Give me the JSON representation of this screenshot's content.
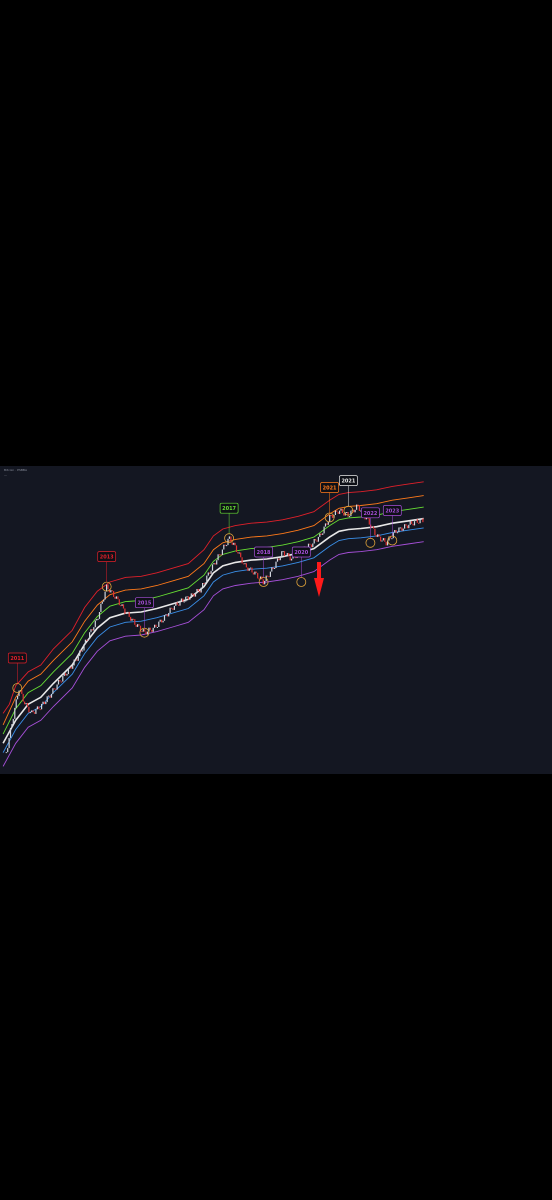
{
  "header": {
    "title": "Bitcoin · PSBBA",
    "subtitle": "—"
  },
  "colors": {
    "background": "#000000",
    "panel": "#141722",
    "bands": [
      "#e0202a",
      "#ff7a1a",
      "#66dd33",
      "#e8e8e8",
      "#3a8fe8",
      "#a64fd8"
    ],
    "candle_up": "#cfd4dc",
    "candle_down": "#e03333",
    "arrow": "#ff1a1a",
    "circle": "#e0a33a"
  },
  "chart_data": {
    "type": "line",
    "title": "",
    "xlabel": "",
    "ylabel": "",
    "x_range": [
      2010.5,
      2024.2
    ],
    "y_scale": "log",
    "grid": false,
    "legend": "none",
    "series": [
      {
        "role": "band-1",
        "color": "#e0202a",
        "x": [
          2010.6,
          2010.8,
          2011.0,
          2011.4,
          2011.8,
          2012.2,
          2012.8,
          2013.2,
          2013.6,
          2014.0,
          2014.5,
          2015.0,
          2015.5,
          2016.0,
          2016.5,
          2017.0,
          2017.3,
          2017.6,
          2018.0,
          2018.5,
          2019.0,
          2019.5,
          2020.0,
          2020.5,
          2021.0,
          2021.3,
          2021.6,
          2022.0,
          2022.5,
          2023.0,
          2023.5,
          2024.0
        ],
        "y": [
          1.2,
          1.6,
          2.4,
          3.0,
          3.3,
          4.0,
          4.8,
          5.8,
          6.5,
          6.9,
          7.1,
          7.15,
          7.3,
          7.5,
          7.7,
          8.3,
          8.9,
          9.2,
          9.35,
          9.45,
          9.5,
          9.6,
          9.75,
          9.95,
          10.45,
          10.7,
          10.78,
          10.82,
          10.9,
          11.05,
          11.15,
          11.25
        ]
      },
      {
        "role": "band-2",
        "color": "#ff7a1a",
        "x": [
          2010.6,
          2011.0,
          2011.4,
          2011.8,
          2012.2,
          2012.8,
          2013.2,
          2013.6,
          2014.0,
          2014.5,
          2015.0,
          2015.5,
          2016.0,
          2016.5,
          2017.0,
          2017.3,
          2017.6,
          2018.0,
          2018.5,
          2019.0,
          2019.5,
          2020.0,
          2020.5,
          2021.0,
          2021.3,
          2021.6,
          2022.0,
          2022.5,
          2023.0,
          2023.5,
          2024.0
        ],
        "y": [
          0.7,
          1.9,
          2.6,
          2.9,
          3.5,
          4.3,
          5.2,
          5.9,
          6.35,
          6.55,
          6.6,
          6.75,
          6.95,
          7.15,
          7.7,
          8.3,
          8.6,
          8.75,
          8.85,
          8.9,
          9.0,
          9.15,
          9.35,
          9.85,
          10.1,
          10.18,
          10.22,
          10.3,
          10.45,
          10.55,
          10.65
        ]
      },
      {
        "role": "band-3",
        "color": "#66dd33",
        "x": [
          2010.6,
          2011.0,
          2011.4,
          2011.8,
          2012.2,
          2012.8,
          2013.2,
          2013.6,
          2014.0,
          2014.5,
          2015.0,
          2015.5,
          2016.0,
          2016.5,
          2017.0,
          2017.3,
          2017.6,
          2018.0,
          2018.5,
          2019.0,
          2019.5,
          2020.0,
          2020.5,
          2021.0,
          2021.3,
          2021.6,
          2022.0,
          2022.5,
          2023.0,
          2023.5,
          2024.0
        ],
        "y": [
          0.3,
          1.4,
          2.1,
          2.4,
          3.0,
          3.8,
          4.7,
          5.4,
          5.85,
          6.05,
          6.1,
          6.25,
          6.45,
          6.65,
          7.2,
          7.8,
          8.1,
          8.25,
          8.35,
          8.4,
          8.5,
          8.65,
          8.85,
          9.35,
          9.6,
          9.68,
          9.72,
          9.8,
          9.95,
          10.05,
          10.15
        ]
      },
      {
        "role": "band-4",
        "color": "#e8e8e8",
        "x": [
          2010.6,
          2011.0,
          2011.4,
          2011.8,
          2012.2,
          2012.8,
          2013.2,
          2013.6,
          2014.0,
          2014.5,
          2015.0,
          2015.5,
          2016.0,
          2016.5,
          2017.0,
          2017.3,
          2017.6,
          2018.0,
          2018.5,
          2019.0,
          2019.5,
          2020.0,
          2020.5,
          2021.0,
          2021.3,
          2021.6,
          2022.0,
          2022.5,
          2023.0,
          2023.5,
          2024.0
        ],
        "y": [
          -0.1,
          0.9,
          1.6,
          1.9,
          2.5,
          3.3,
          4.2,
          4.9,
          5.35,
          5.55,
          5.6,
          5.75,
          5.95,
          6.15,
          6.7,
          7.3,
          7.6,
          7.75,
          7.85,
          7.9,
          8.0,
          8.15,
          8.35,
          8.85,
          9.1,
          9.18,
          9.22,
          9.3,
          9.45,
          9.55,
          9.65
        ]
      },
      {
        "role": "band-5",
        "color": "#3a8fe8",
        "x": [
          2010.6,
          2011.0,
          2011.4,
          2011.8,
          2012.2,
          2012.8,
          2013.2,
          2013.6,
          2014.0,
          2014.5,
          2015.0,
          2015.5,
          2016.0,
          2016.5,
          2017.0,
          2017.3,
          2017.6,
          2018.0,
          2018.5,
          2019.0,
          2019.5,
          2020.0,
          2020.5,
          2021.0,
          2021.3,
          2021.6,
          2022.0,
          2022.5,
          2023.0,
          2023.5,
          2024.0
        ],
        "y": [
          -0.5,
          0.5,
          1.2,
          1.5,
          2.1,
          2.9,
          3.8,
          4.5,
          4.95,
          5.15,
          5.2,
          5.35,
          5.55,
          5.75,
          6.3,
          6.9,
          7.2,
          7.35,
          7.45,
          7.5,
          7.6,
          7.75,
          7.95,
          8.45,
          8.7,
          8.78,
          8.82,
          8.9,
          9.05,
          9.15,
          9.25
        ]
      },
      {
        "role": "band-6",
        "color": "#a64fd8",
        "x": [
          2010.6,
          2011.0,
          2011.4,
          2011.8,
          2012.2,
          2012.8,
          2013.2,
          2013.6,
          2014.0,
          2014.5,
          2015.0,
          2015.5,
          2016.0,
          2016.5,
          2017.0,
          2017.3,
          2017.6,
          2018.0,
          2018.5,
          2019.0,
          2019.5,
          2020.0,
          2020.5,
          2021.0,
          2021.3,
          2021.6,
          2022.0,
          2022.5,
          2023.0,
          2023.5,
          2024.0
        ],
        "y": [
          -1.1,
          -0.1,
          0.6,
          0.9,
          1.5,
          2.3,
          3.2,
          3.9,
          4.35,
          4.55,
          4.6,
          4.75,
          4.95,
          5.15,
          5.7,
          6.3,
          6.6,
          6.75,
          6.85,
          6.9,
          7.0,
          7.15,
          7.35,
          7.85,
          8.1,
          8.18,
          8.22,
          8.3,
          8.45,
          8.55,
          8.65
        ]
      },
      {
        "role": "price",
        "color": "#cfd4dc",
        "x": [
          2010.7,
          2010.9,
          2011.1,
          2011.3,
          2011.5,
          2011.8,
          2012.1,
          2012.4,
          2012.7,
          2013.0,
          2013.3,
          2013.6,
          2013.9,
          2014.2,
          2014.5,
          2014.8,
          2015.1,
          2015.4,
          2015.7,
          2016.0,
          2016.3,
          2016.6,
          2016.9,
          2017.2,
          2017.5,
          2017.8,
          2018.0,
          2018.3,
          2018.6,
          2018.9,
          2019.2,
          2019.5,
          2019.8,
          2020.1,
          2020.4,
          2020.7,
          2021.0,
          2021.3,
          2021.6,
          2021.9,
          2022.2,
          2022.5,
          2022.8,
          2023.1,
          2023.4,
          2023.7,
          2024.0
        ],
        "y": [
          -0.5,
          0.9,
          2.3,
          1.6,
          1.2,
          1.5,
          2.0,
          2.6,
          3.1,
          3.7,
          4.5,
          5.3,
          6.7,
          6.2,
          5.6,
          5.1,
          4.7,
          4.9,
          5.3,
          5.8,
          6.1,
          6.3,
          6.6,
          7.4,
          8.1,
          8.8,
          8.4,
          7.6,
          7.3,
          6.9,
          7.5,
          8.2,
          7.9,
          8.3,
          8.5,
          8.9,
          9.7,
          10.0,
          9.8,
          10.2,
          9.6,
          8.9,
          8.6,
          9.1,
          9.3,
          9.5,
          9.6
        ]
      }
    ],
    "annotations": [
      {
        "label": "2011",
        "x": 2011.05,
        "y": 2.3,
        "color": "#e0202a"
      },
      {
        "label": "2013",
        "x": 2013.9,
        "y": 6.7,
        "color": "#e0202a"
      },
      {
        "label": "2015",
        "x": 2015.1,
        "y": 4.7,
        "color": "#a64fd8"
      },
      {
        "label": "2017",
        "x": 2017.8,
        "y": 8.8,
        "color": "#66dd33"
      },
      {
        "label": "2018",
        "x": 2018.9,
        "y": 6.9,
        "color": "#a64fd8"
      },
      {
        "label": "2020",
        "x": 2020.1,
        "y": 6.9,
        "color": "#a64fd8"
      },
      {
        "label": "2021",
        "x": 2021.0,
        "y": 9.7,
        "color": "#ff7a1a"
      },
      {
        "label": "2021",
        "x": 2021.6,
        "y": 10.0,
        "color": "#e8e8e8"
      },
      {
        "label": "2022",
        "x": 2022.3,
        "y": 8.6,
        "color": "#a64fd8"
      },
      {
        "label": "2023",
        "x": 2023.0,
        "y": 8.7,
        "color": "#a64fd8"
      }
    ]
  }
}
